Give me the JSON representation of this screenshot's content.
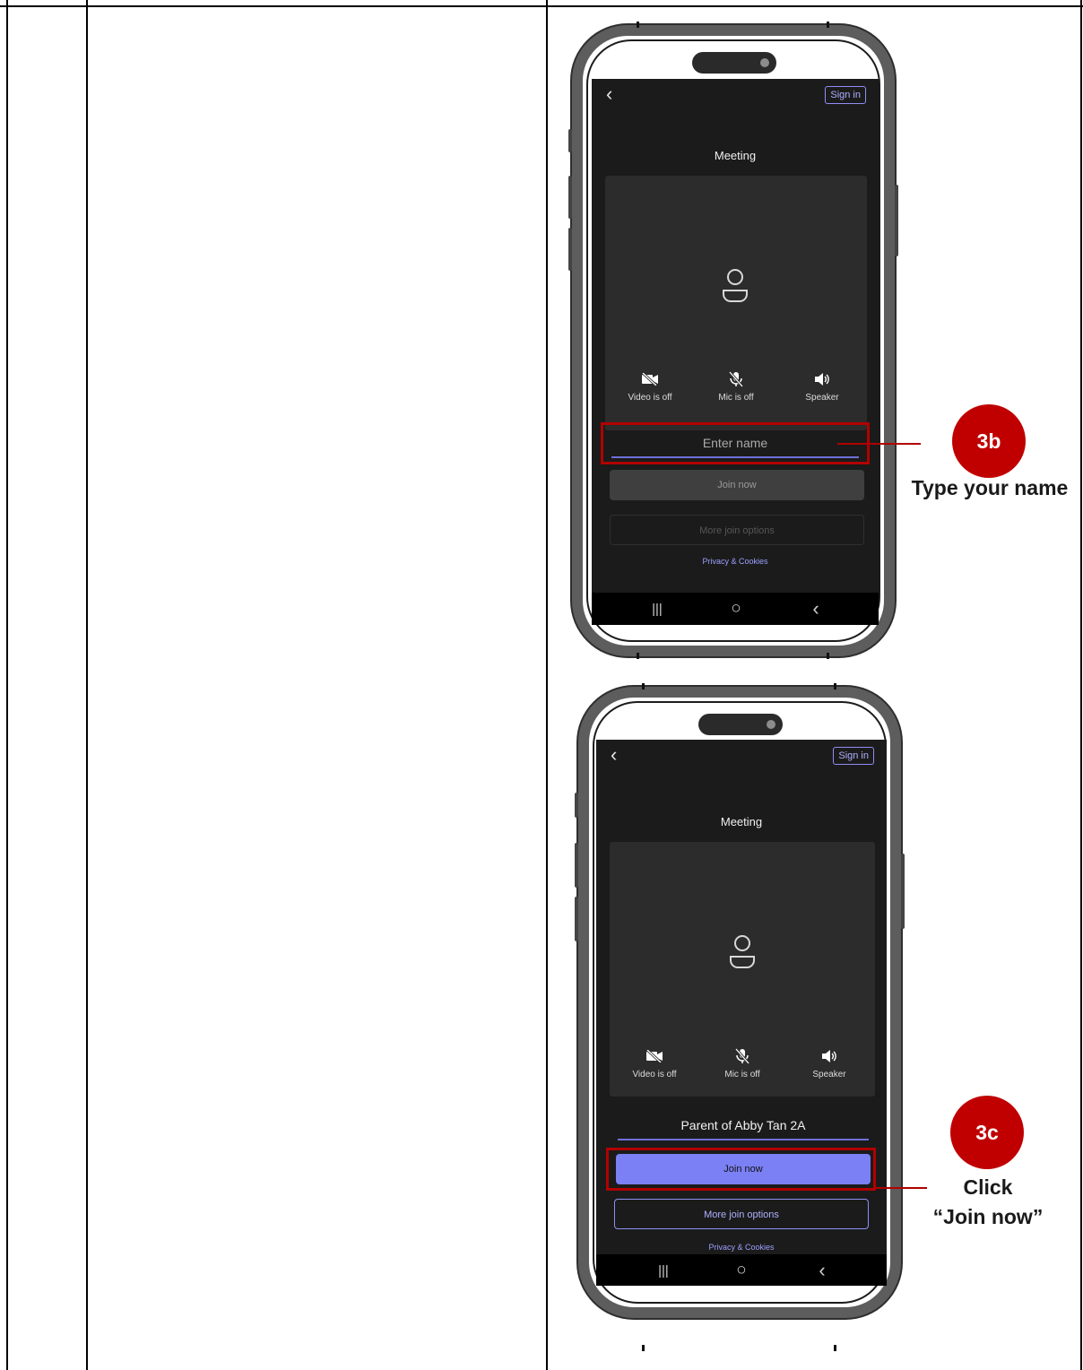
{
  "phone1": {
    "back_glyph": "‹",
    "sign_in": "Sign in",
    "title": "Meeting",
    "controls": [
      {
        "label": "Video is off",
        "icon": "video-off-icon"
      },
      {
        "label": "Mic is off",
        "icon": "mic-off-icon"
      },
      {
        "label": "Speaker",
        "icon": "speaker-icon"
      }
    ],
    "name_placeholder": "Enter name",
    "join_now": "Join now",
    "more_join_options": "More join options",
    "privacy": "Privacy & Cookies",
    "nav": {
      "recents": "|||",
      "home": "○",
      "back": "‹"
    }
  },
  "phone2": {
    "back_glyph": "‹",
    "sign_in": "Sign in",
    "title": "Meeting",
    "controls": [
      {
        "label": "Video is off",
        "icon": "video-off-icon"
      },
      {
        "label": "Mic is off",
        "icon": "mic-off-icon"
      },
      {
        "label": "Speaker",
        "icon": "speaker-icon"
      }
    ],
    "name_value": "Parent of Abby Tan 2A",
    "join_now": "Join now",
    "more_join_options": "More join options",
    "privacy": "Privacy & Cookies",
    "nav": {
      "recents": "|||",
      "home": "○",
      "back": "‹"
    }
  },
  "annotations": {
    "step1": {
      "badge": "3b",
      "caption": "Type your name"
    },
    "step2": {
      "badge": "3c",
      "caption_line1": "Click",
      "caption_line2": "“Join now”"
    }
  },
  "colors": {
    "accent": "#7b80f4",
    "highlight": "#b20000",
    "screen_bg": "#1b1b1b"
  }
}
